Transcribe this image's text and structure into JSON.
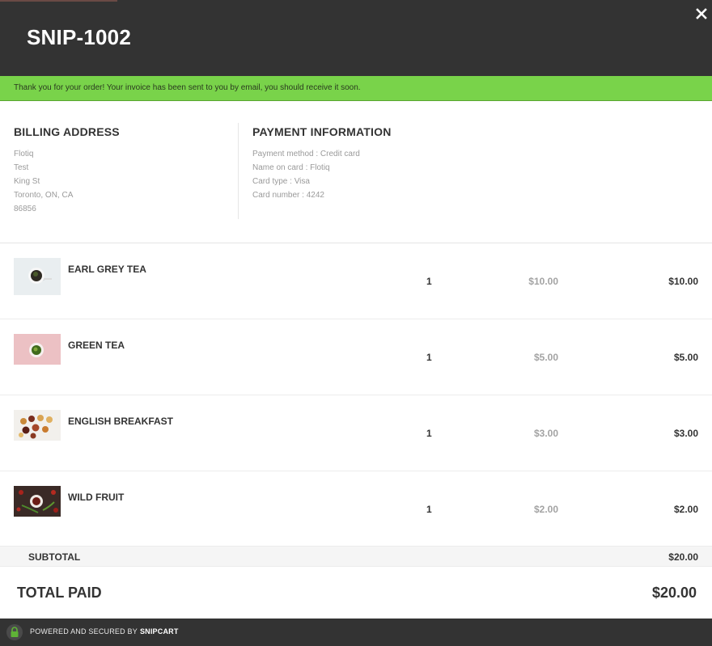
{
  "header": {
    "title": "SNIP-1002",
    "close_icon": "close-icon"
  },
  "notice": {
    "text": "Thank you for your order! Your invoice has been sent to you by email, you should receive it soon.",
    "color": "#79d34a"
  },
  "billing": {
    "heading": "BILLING ADDRESS",
    "lines": [
      "Flotiq",
      "Test",
      "King St",
      "Toronto, ON, CA",
      "86856"
    ]
  },
  "payment": {
    "heading": "PAYMENT INFORMATION",
    "lines": [
      "Payment method : Credit card",
      "Name on card : Flotiq",
      "Card type : Visa",
      "Card number : 4242"
    ]
  },
  "items": [
    {
      "name": "EARL GREY TEA",
      "quantity": "1",
      "unit_price": "$10.00",
      "total": "$10.00",
      "image": "earl-grey-tea-image"
    },
    {
      "name": "GREEN TEA",
      "quantity": "1",
      "unit_price": "$5.00",
      "total": "$5.00",
      "image": "green-tea-image"
    },
    {
      "name": "ENGLISH BREAKFAST",
      "quantity": "1",
      "unit_price": "$3.00",
      "total": "$3.00",
      "image": "english-breakfast-image"
    },
    {
      "name": "WILD FRUIT",
      "quantity": "1",
      "unit_price": "$2.00",
      "total": "$2.00",
      "image": "wild-fruit-image"
    }
  ],
  "summary": {
    "subtotal_label": "SUBTOTAL",
    "subtotal_value": "$20.00",
    "total_label": "TOTAL PAID",
    "total_value": "$20.00"
  },
  "footer": {
    "text": "POWERED AND SECURED BY",
    "brand": "SNIPCART",
    "lock_icon": "lock-icon"
  },
  "colors": {
    "header_bg": "#333333",
    "notice_bg": "#79d34a",
    "lock": "#5fb336"
  }
}
